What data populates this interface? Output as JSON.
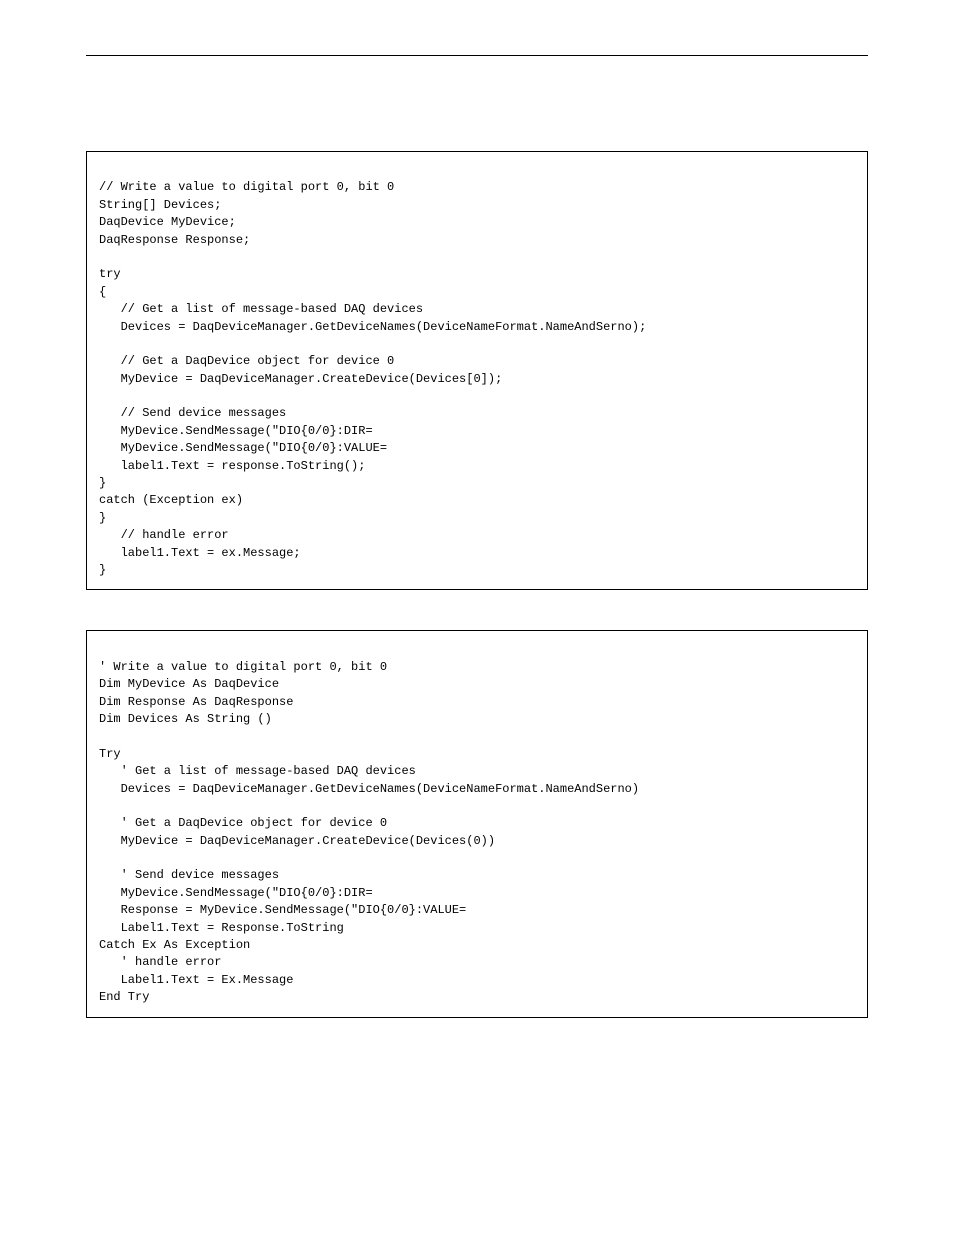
{
  "csharp": {
    "lines": [
      "// Write a value to digital port 0, bit 0",
      "String[] Devices;",
      "DaqDevice MyDevice;",
      "DaqResponse Response;",
      "",
      "try",
      "{",
      "   // Get a list of message-based DAQ devices",
      "   Devices = DaqDeviceManager.GetDeviceNames(DeviceNameFormat.NameAndSerno);",
      "",
      "   // Get a DaqDevice object for device 0",
      "   MyDevice = DaqDeviceManager.CreateDevice(Devices[0]);",
      "",
      "   // Send device messages",
      "   MyDevice.SendMessage(\"DIO{0/0}:DIR=",
      "   MyDevice.SendMessage(\"DIO{0/0}:VALUE=",
      "   label1.Text = response.ToString();",
      "}",
      "catch (Exception ex)",
      "}",
      "   // handle error",
      "   label1.Text = ex.Message;",
      "}"
    ]
  },
  "vb": {
    "lines": [
      "' Write a value to digital port 0, bit 0",
      "Dim MyDevice As DaqDevice",
      "Dim Response As DaqResponse",
      "Dim Devices As String ()",
      "",
      "Try",
      "   ' Get a list of message-based DAQ devices",
      "   Devices = DaqDeviceManager.GetDeviceNames(DeviceNameFormat.NameAndSerno)",
      "",
      "   ' Get a DaqDevice object for device 0",
      "   MyDevice = DaqDeviceManager.CreateDevice(Devices(0))",
      "",
      "   ' Send device messages",
      "   MyDevice.SendMessage(\"DIO{0/0}:DIR=",
      "   Response = MyDevice.SendMessage(\"DIO{0/0}:VALUE=",
      "   Label1.Text = Response.ToString",
      "Catch Ex As Exception",
      "   ' handle error",
      "   Label1.Text = Ex.Message",
      "End Try"
    ]
  }
}
